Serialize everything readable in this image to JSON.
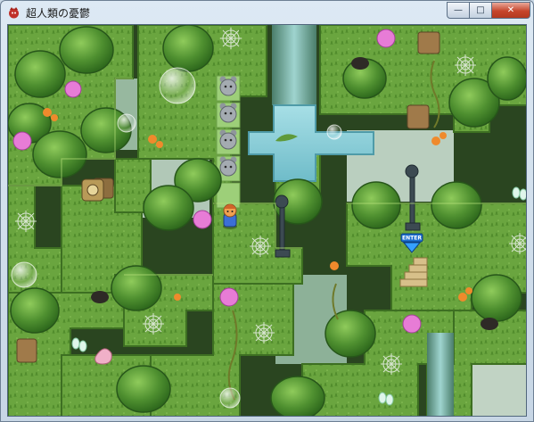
{
  "window": {
    "title": "超人類の憂鬱",
    "controls": {
      "minimize_glyph": "—",
      "maximize_glyph": "□",
      "close_glyph": "✕"
    }
  },
  "game": {
    "enter_sign": "ENTER",
    "icons": {
      "app": "game-app-icon",
      "player": "player-character-sprite",
      "signpost": "enter-arrow-sign"
    },
    "palette": {
      "grass": "#5f9a3a",
      "grass_light": "#86bf52",
      "canopy": "#4e8f2f",
      "water": "#8fd0dc",
      "void": "#2a4520",
      "cloud": "#cfe3d6"
    }
  }
}
